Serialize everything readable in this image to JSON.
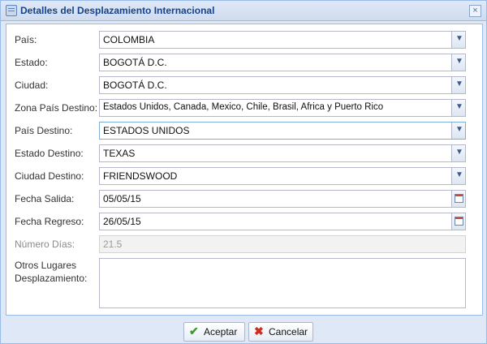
{
  "window": {
    "title": "Detalles del Desplazamiento Internacional",
    "close_label": "×"
  },
  "form": {
    "pais": {
      "label": "País:",
      "value": "COLOMBIA"
    },
    "estado": {
      "label": "Estado:",
      "value": "BOGOTÁ D.C."
    },
    "ciudad": {
      "label": "Ciudad:",
      "value": "BOGOTÁ D.C."
    },
    "zona": {
      "label": "Zona País Destino:",
      "value": "Estados Unidos, Canada, Mexico, Chile, Brasil, Africa y Puerto Rico"
    },
    "pais_destino": {
      "label": "País Destino:",
      "value": "ESTADOS UNIDOS"
    },
    "estado_destino": {
      "label": "Estado Destino:",
      "value": "TEXAS"
    },
    "ciudad_destino": {
      "label": "Ciudad Destino:",
      "value": "FRIENDSWOOD"
    },
    "fecha_salida": {
      "label": "Fecha Salida:",
      "value": "05/05/15"
    },
    "fecha_regreso": {
      "label": "Fecha Regreso:",
      "value": "26/05/15"
    },
    "numero_dias": {
      "label": "Número Días:",
      "value": "21.5"
    },
    "otros_lugares": {
      "label_line1": "Otros Lugares",
      "label_line2": "Desplazamiento:",
      "value": ""
    }
  },
  "buttons": {
    "accept": "Aceptar",
    "cancel": "Cancelar"
  },
  "icons": {
    "title": "form-window-icon",
    "dropdown": "chevron-down-icon",
    "calendar": "calendar-icon",
    "accept": "check-icon",
    "cancel": "x-icon"
  }
}
